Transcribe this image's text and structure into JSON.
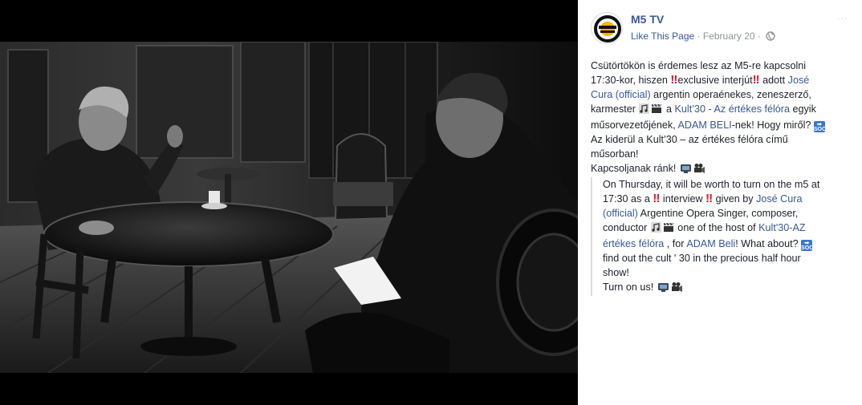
{
  "post": {
    "page_name": "M5 TV",
    "like_label": "Like This Page",
    "date": "February 20",
    "menu_icon": "more-dots-icon",
    "privacy_icon": "globe-icon",
    "hu": {
      "l1": "Csütörtökön is érdemes lesz az M5-re kapcsolni",
      "l2a": "17:30-kor, hiszen ",
      "l2b": "exclusive interjút",
      "l2c": " adott ",
      "l2link": "José",
      "l3link": "Cura (official)",
      "l3b": " argentin operaénekes, zeneszerző,",
      "l4a": "karmester ",
      "l4b": " a ",
      "l4link": "Kult’30 - Az értékes félóra",
      "l4c": " egyik",
      "l5a": "műsorvezetőjének, ",
      "l5link": "ADAM BELI",
      "l5b": "-nek! Hogy miről?",
      "l6": "Az kiderül a Kult’30 – az értékes félóra című",
      "l7": "műsorban!",
      "l8": "Kapcsoljanak ránk!"
    },
    "en": {
      "l1": "On Thursday, it will be worth to turn on the m5 at",
      "l2a": "17:30 as a ",
      "l2b": " interview ",
      "l2c": "  given by ",
      "l2link": "José Cura",
      "l3link": "(official)",
      "l3b": " Argentine Opera Singer, composer,",
      "l4a": "conductor ",
      "l4b": " one of the host of ",
      "l4link": "Kult'30-AZ",
      "l5link": "értékes félóra",
      "l5b": " , for ",
      "l5link2": "ADAM Beli",
      "l5c": "! What about?",
      "l6": "find out the cult ' 30 in the precious half hour",
      "l7": "show!",
      "l8": "Turn on us!"
    },
    "emoji": {
      "double_exclamation": "‼",
      "soon_top": "➡",
      "soon_text": "SOON"
    },
    "colors": {
      "link": "#385898",
      "text": "#1d2129",
      "meta": "#90949c",
      "exclamation": "#e2172b",
      "soon": "#3a76d0"
    }
  }
}
